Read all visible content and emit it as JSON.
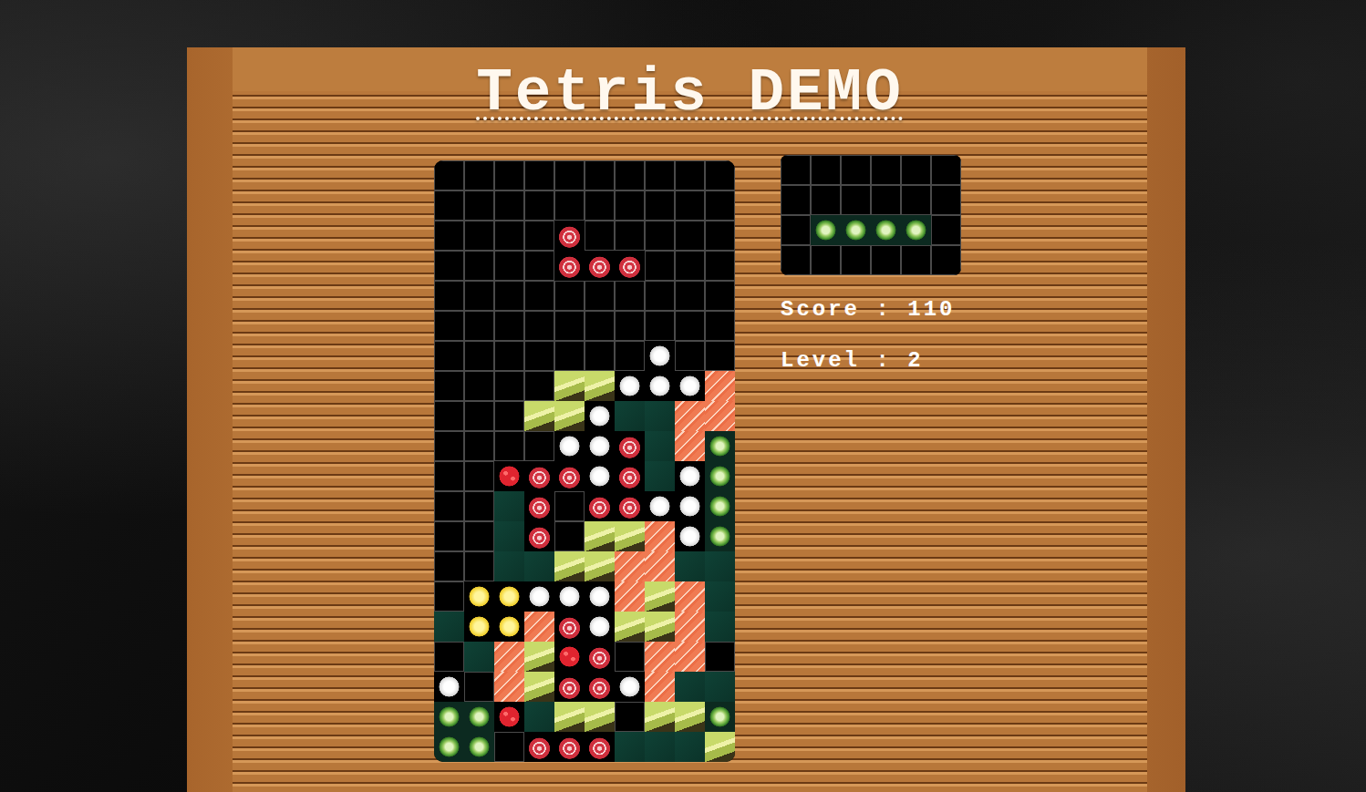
{
  "title": "Tetris DEMO",
  "legend": {
    ".": "empty",
    "t": "tuna",
    "o": "roe",
    "s": "salmon",
    "r": "rice",
    "c": "cucumber",
    "a": "avocado",
    "n": "nori",
    "e": "tamago"
  },
  "board": {
    "rows": [
      "..........",
      "..........",
      "....t.....",
      "....ttt...",
      "..........",
      "..........",
      ".......r..",
      "....aarrrs",
      "...aarnnss",
      "....rrtnsc",
      "..ottrtnrc",
      "..nt.ttrrc",
      "..nt.aasrc",
      "..nnaassnn",
      ".eerrrsasn",
      "neestraasn",
      ".nsaot.ss.",
      "r.sattrsnn",
      "cconaa.aac",
      "cc.tttnnna"
    ]
  },
  "next": {
    "rows": [
      "......",
      "......",
      ".cccc.",
      "......"
    ]
  },
  "stats": [
    {
      "label": "Score",
      "separator": " : ",
      "value": "110"
    },
    {
      "label": "Level",
      "separator": " : ",
      "value": "2"
    }
  ]
}
